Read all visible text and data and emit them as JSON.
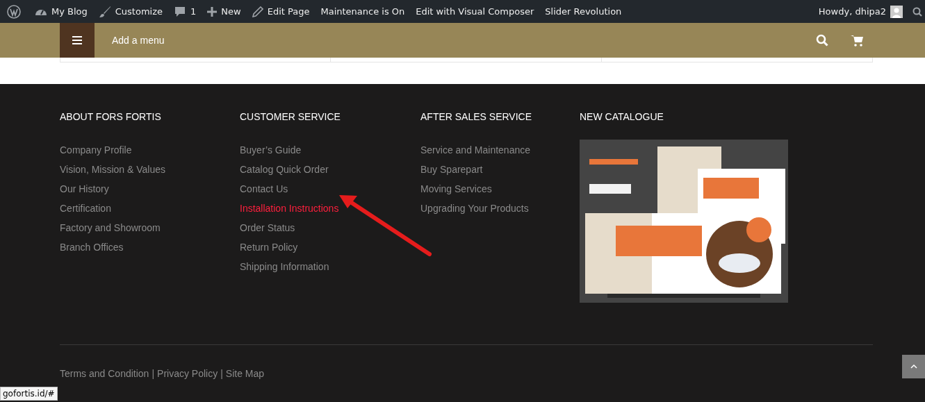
{
  "admin_bar": {
    "items": [
      {
        "kind": "wp"
      },
      {
        "kind": "dashboard",
        "label": "My Blog"
      },
      {
        "kind": "brush",
        "label": "Customize"
      },
      {
        "kind": "comment",
        "label": "1"
      },
      {
        "kind": "plus",
        "label": "New"
      },
      {
        "kind": "pencil",
        "label": "Edit Page"
      },
      {
        "kind": "text",
        "label": "Maintenance is On"
      },
      {
        "kind": "text",
        "label": "Edit with Visual Composer"
      },
      {
        "kind": "text",
        "label": "Slider Revolution"
      }
    ],
    "greeting": "Howdy, dhipa2"
  },
  "nav": {
    "menu_label": "Add a menu"
  },
  "footer": {
    "columns": [
      {
        "title": "ABOUT FORS FORTIS",
        "links": [
          {
            "label": "Company Profile",
            "hovered": false
          },
          {
            "label": "Vision, Mission & Values",
            "hovered": false
          },
          {
            "label": "Our History",
            "hovered": false
          },
          {
            "label": "Certification",
            "hovered": false
          },
          {
            "label": "Factory and Showroom",
            "hovered": false
          },
          {
            "label": "Branch Offices",
            "hovered": false
          }
        ]
      },
      {
        "title": "CUSTOMER SERVICE",
        "links": [
          {
            "label": "Buyer’s Guide",
            "hovered": false
          },
          {
            "label": "Catalog Quick Order",
            "hovered": false
          },
          {
            "label": "Contact Us",
            "hovered": false
          },
          {
            "label": "Installation Instructions",
            "hovered": true
          },
          {
            "label": "Order Status",
            "hovered": false
          },
          {
            "label": "Return Policy",
            "hovered": false
          },
          {
            "label": "Shipping Information",
            "hovered": false
          }
        ]
      },
      {
        "title": "AFTER SALES SERVICE",
        "links": [
          {
            "label": "Service and Maintenance",
            "hovered": false
          },
          {
            "label": "Buy Sparepart",
            "hovered": false
          },
          {
            "label": "Moving Services",
            "hovered": false
          },
          {
            "label": "Upgrading Your Products",
            "hovered": false
          }
        ]
      },
      {
        "title": "NEW CATALOGUE"
      }
    ],
    "bottom_links": [
      "Terms and Condition",
      "Privacy Policy",
      "Site Map"
    ],
    "separator": "|"
  },
  "status_bar": {
    "url": "gofortis.id/#"
  }
}
